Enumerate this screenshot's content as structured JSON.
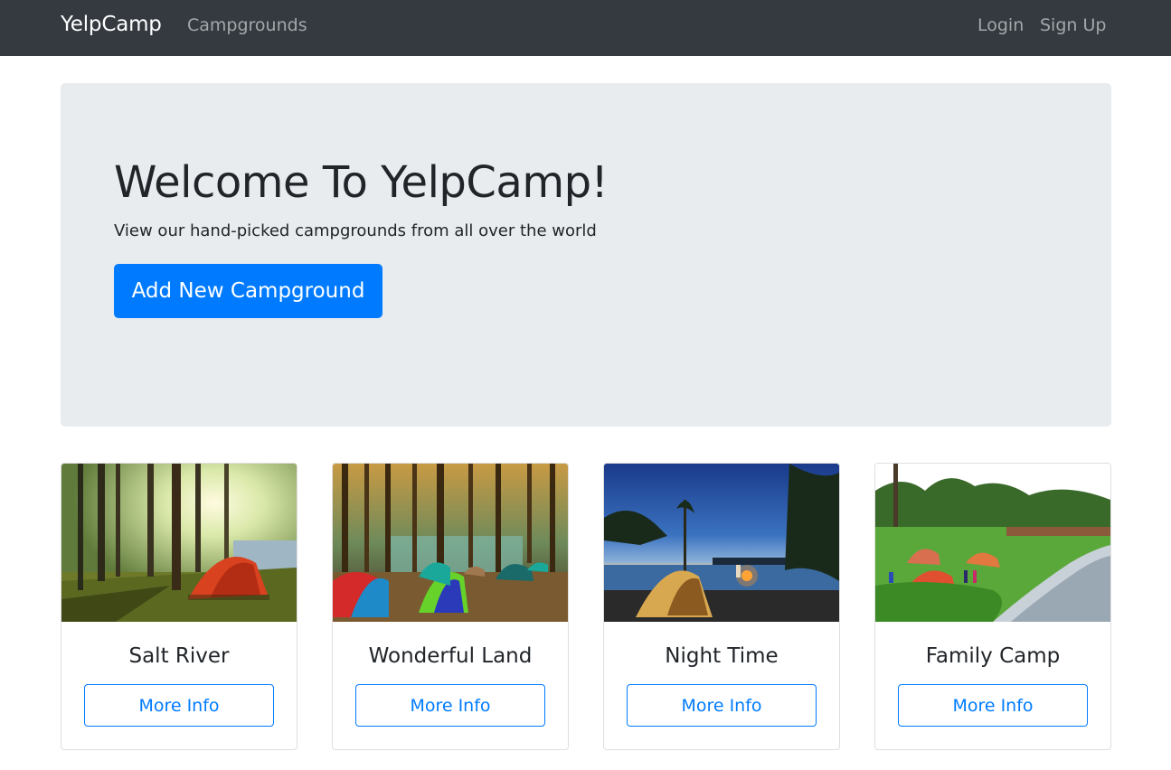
{
  "navbar": {
    "brand": "YelpCamp",
    "campgrounds_link": "Campgrounds",
    "login_link": "Login",
    "signup_link": "Sign Up"
  },
  "jumbotron": {
    "title": "Welcome To YelpCamp!",
    "subtitle": "View our hand-picked campgrounds from all over the world",
    "add_button": "Add New Campground"
  },
  "campgrounds": [
    {
      "name": "Salt River",
      "button": "More Info"
    },
    {
      "name": "Wonderful Land",
      "button": "More Info"
    },
    {
      "name": "Night Time",
      "button": "More Info"
    },
    {
      "name": "Family Camp",
      "button": "More Info"
    }
  ],
  "colors": {
    "navbar_bg": "#343a40",
    "jumbotron_bg": "#e9ecef",
    "primary": "#007bff"
  }
}
